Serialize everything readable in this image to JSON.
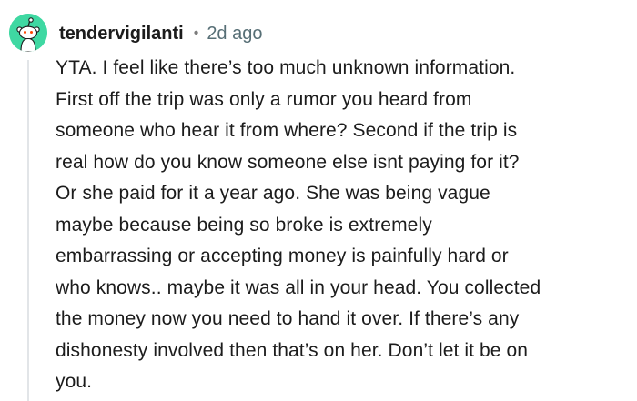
{
  "comment": {
    "author": "tendervigilanti",
    "separator": "•",
    "timestamp": "2d ago",
    "avatar_icon": "snoo-avatar-icon",
    "avatar_color": "#3fd8a2",
    "body_lines": [
      "YTA. I feel like there’s too much unknown information.",
      "First off the trip was only a rumor you heard from",
      "someone who hear it from where? Second if the trip is",
      "real how do you know someone else isnt paying for it?",
      "Or she paid for it a year ago. She was being vague",
      "maybe because being so broke is extremely",
      "embarrassing or accepting money is painfully hard or",
      "who knows.. maybe it was all in your head. You collected",
      "the money now you need to hand it over. If there’s any",
      "dishonesty involved then that’s on her. Don’t let it be on",
      "you."
    ]
  }
}
